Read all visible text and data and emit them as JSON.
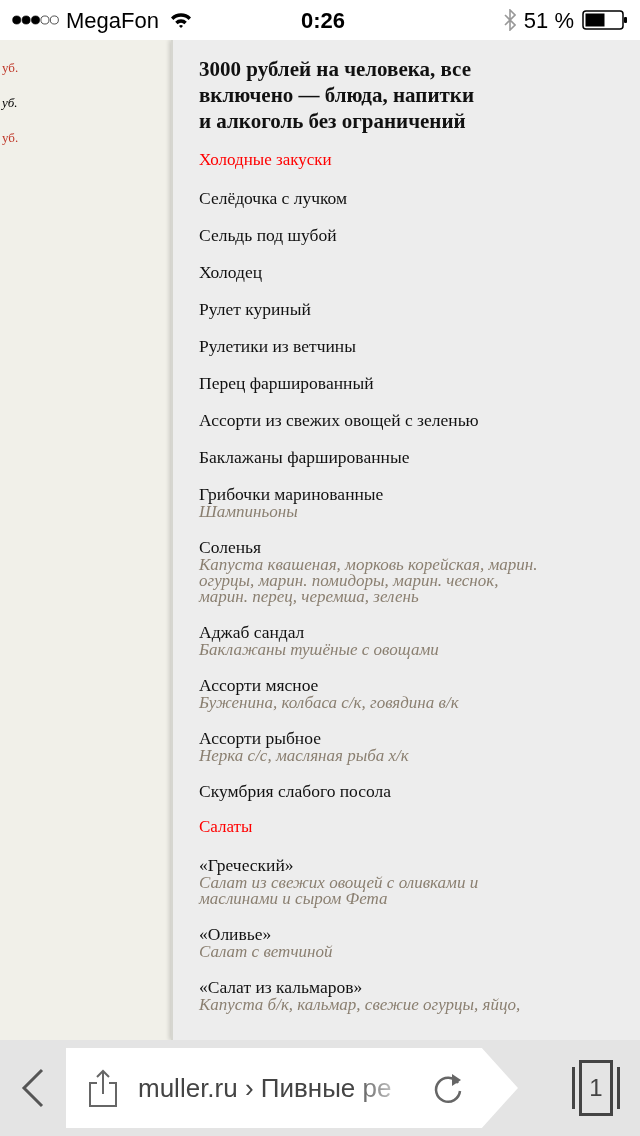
{
  "status_bar": {
    "carrier": "MegaFon",
    "time": "0:26",
    "battery": "51 %"
  },
  "side_column": [
    {
      "text": "уб.",
      "kind": "price"
    },
    {
      "text": "уб.",
      "kind": "note"
    },
    {
      "text": "уб.",
      "kind": "price"
    }
  ],
  "menu": {
    "title": "3000 рублей на человека, все включено — блюда, напитки и алкоголь без ограничений",
    "sections": [
      {
        "heading": "Холодные закуски",
        "items": [
          {
            "name": "Селёдочка с лучком"
          },
          {
            "name": "Сельдь под шубой"
          },
          {
            "name": "Холодец"
          },
          {
            "name": "Рулет куриный"
          },
          {
            "name": "Рулетики из ветчины"
          },
          {
            "name": "Перец фаршированный"
          },
          {
            "name": "Ассорти из свежих овощей с зеленью"
          },
          {
            "name": "Баклажаны фаршированные"
          },
          {
            "name": "Грибочки маринованные",
            "description": "Шампиньоны"
          },
          {
            "name": "Соленья",
            "description": "Капуста квашеная, морковь корейская, марин. огурцы, марин. помидоры, марин. чеснок, марин. перец,  черемша, зелень"
          },
          {
            "name": "Аджаб сандал",
            "description": "Баклажаны тушёные с овощами"
          },
          {
            "name": "Ассорти мясное",
            "description": "Буженина, колбаса с/к, говядина в/к"
          },
          {
            "name": "Ассорти рыбное",
            "description": "Нерка с/с, масляная рыба х/к"
          },
          {
            "name": "Скумбрия слабого посола"
          }
        ]
      },
      {
        "heading": "Салаты",
        "items": [
          {
            "name": "«Греческий»",
            "description": "Салат из свежих овощей с оливками и маслинами и сыром Фета"
          },
          {
            "name": "«Оливье»",
            "description": "Салат с ветчиной"
          },
          {
            "name": "«Салат из кальмаров»",
            "description": "Капуста б/к, кальмар, свежие огурцы, яйцо,"
          }
        ]
      }
    ]
  },
  "toolbar": {
    "url": "muller.ru › Пивные ре",
    "tab_count": "1"
  }
}
